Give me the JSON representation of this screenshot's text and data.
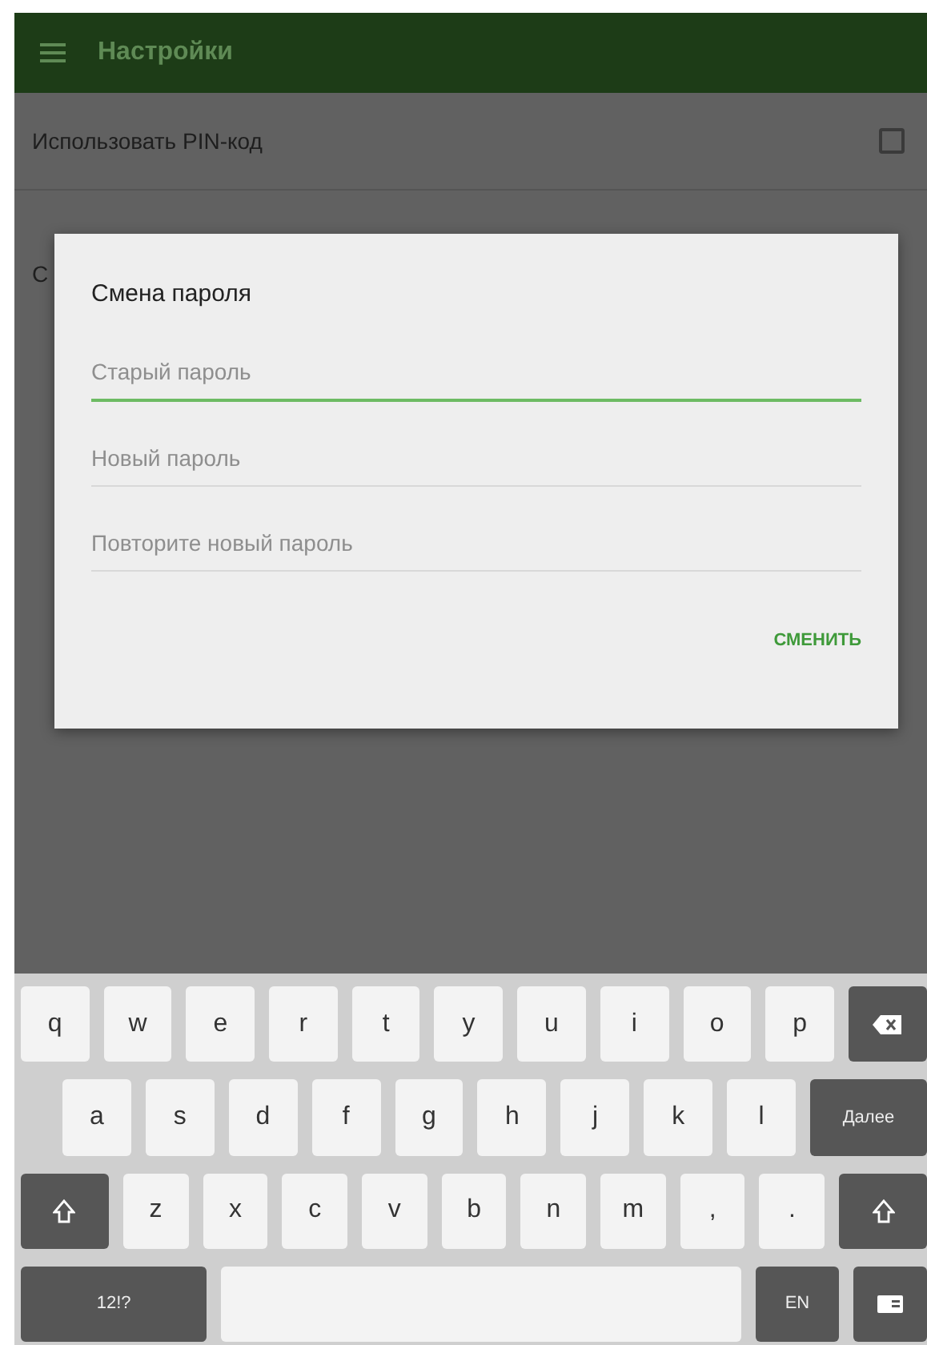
{
  "app_bar": {
    "title": "Настройки"
  },
  "settings": [
    {
      "label": "Использовать PIN-код",
      "checked": false
    },
    {
      "label": "С"
    }
  ],
  "dialog": {
    "title": "Смена пароля",
    "fields": [
      {
        "placeholder": "Старый пароль",
        "focused": true
      },
      {
        "placeholder": "Новый пароль",
        "focused": false
      },
      {
        "placeholder": "Повторите новый пароль",
        "focused": false
      }
    ],
    "button": "СМЕНИТЬ"
  },
  "keyboard": {
    "rows": [
      {
        "keys": [
          {
            "kind": "char",
            "label": "q"
          },
          {
            "kind": "char",
            "label": "w"
          },
          {
            "kind": "char",
            "label": "e"
          },
          {
            "kind": "char",
            "label": "r"
          },
          {
            "kind": "char",
            "label": "t"
          },
          {
            "kind": "char",
            "label": "y"
          },
          {
            "kind": "char",
            "label": "u"
          },
          {
            "kind": "char",
            "label": "i"
          },
          {
            "kind": "char",
            "label": "o"
          },
          {
            "kind": "char",
            "label": "p"
          },
          {
            "kind": "backspace"
          }
        ]
      },
      {
        "keys": [
          {
            "kind": "char",
            "label": "a"
          },
          {
            "kind": "char",
            "label": "s"
          },
          {
            "kind": "char",
            "label": "d"
          },
          {
            "kind": "char",
            "label": "f"
          },
          {
            "kind": "char",
            "label": "g"
          },
          {
            "kind": "char",
            "label": "h"
          },
          {
            "kind": "char",
            "label": "j"
          },
          {
            "kind": "char",
            "label": "k"
          },
          {
            "kind": "char",
            "label": "l"
          },
          {
            "kind": "action",
            "label": "Далее"
          }
        ]
      },
      {
        "keys": [
          {
            "kind": "shift"
          },
          {
            "kind": "char",
            "label": "z"
          },
          {
            "kind": "char",
            "label": "x"
          },
          {
            "kind": "char",
            "label": "c"
          },
          {
            "kind": "char",
            "label": "v"
          },
          {
            "kind": "char",
            "label": "b"
          },
          {
            "kind": "char",
            "label": "n"
          },
          {
            "kind": "char",
            "label": "m"
          },
          {
            "kind": "char",
            "label": ","
          },
          {
            "kind": "char",
            "label": "."
          },
          {
            "kind": "shift"
          }
        ]
      },
      {
        "keys": [
          {
            "kind": "action",
            "label": "12!?"
          },
          {
            "kind": "space"
          },
          {
            "kind": "action",
            "label": "EN"
          },
          {
            "kind": "hide"
          }
        ]
      }
    ]
  }
}
